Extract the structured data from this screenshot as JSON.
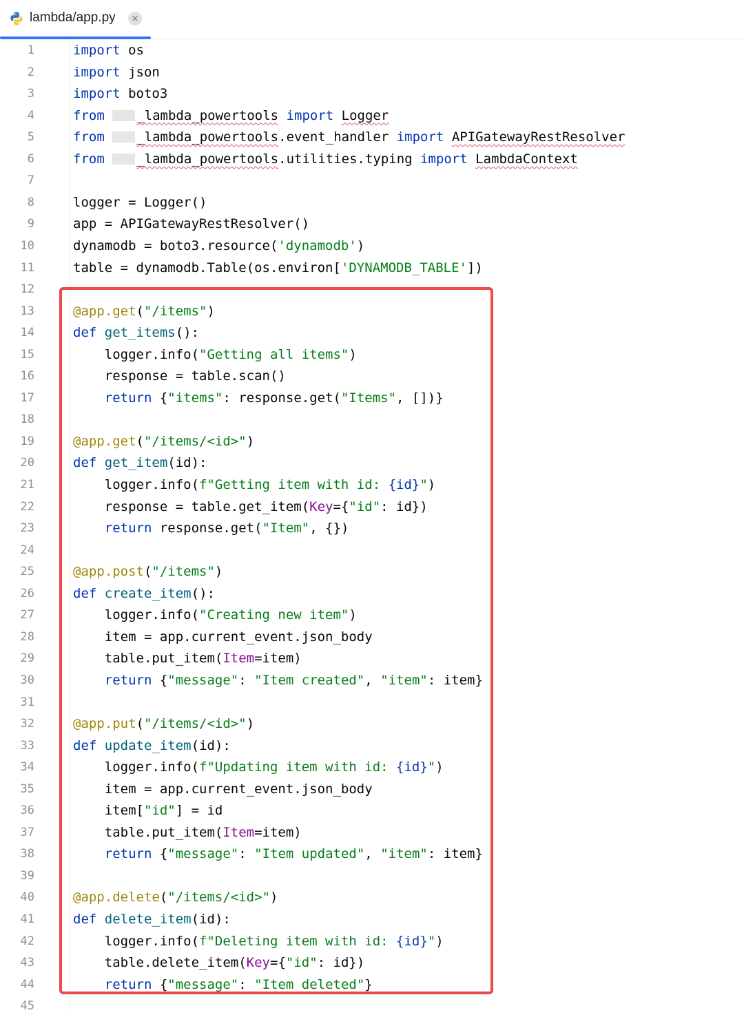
{
  "tab": {
    "label": "lambda/app.py",
    "close_icon": "×",
    "file_icon": "python-icon"
  },
  "colors": {
    "keyword": "#0033b3",
    "string": "#067d17",
    "decorator": "#9e880d",
    "function": "#00627a",
    "param": "#871094",
    "highlight_border": "#ea4a48",
    "tab_underline": "#3574f0"
  },
  "lines": [
    {
      "n": "1",
      "tokens": [
        {
          "t": "import",
          "c": "kw"
        },
        {
          "t": " os"
        }
      ]
    },
    {
      "n": "2",
      "tokens": [
        {
          "t": "import",
          "c": "kw"
        },
        {
          "t": " json"
        }
      ]
    },
    {
      "n": "3",
      "tokens": [
        {
          "t": "import",
          "c": "kw"
        },
        {
          "t": " boto3"
        }
      ]
    },
    {
      "n": "4",
      "tokens": [
        {
          "t": "from",
          "c": "kw"
        },
        {
          "t": " "
        },
        {
          "t": "",
          "c": "redact"
        },
        {
          "t": "_lambda_powertools",
          "c": "err"
        },
        {
          "t": " "
        },
        {
          "t": "import",
          "c": "kw"
        },
        {
          "t": " "
        },
        {
          "t": "Logger",
          "c": "err"
        }
      ]
    },
    {
      "n": "5",
      "tokens": [
        {
          "t": "from",
          "c": "kw"
        },
        {
          "t": " "
        },
        {
          "t": "",
          "c": "redact"
        },
        {
          "t": "_lambda_powertools",
          "c": "err"
        },
        {
          "t": ".event_handler "
        },
        {
          "t": "import",
          "c": "kw"
        },
        {
          "t": " "
        },
        {
          "t": "APIGatewayRestResolver",
          "c": "err"
        }
      ]
    },
    {
      "n": "6",
      "tokens": [
        {
          "t": "from",
          "c": "kw"
        },
        {
          "t": " "
        },
        {
          "t": "",
          "c": "redact"
        },
        {
          "t": "_lambda_powertools",
          "c": "err"
        },
        {
          "t": ".utilities.typing "
        },
        {
          "t": "import",
          "c": "kw"
        },
        {
          "t": " "
        },
        {
          "t": "LambdaContext",
          "c": "err"
        }
      ]
    },
    {
      "n": "7",
      "tokens": []
    },
    {
      "n": "8",
      "tokens": [
        {
          "t": "logger = Logger()"
        }
      ]
    },
    {
      "n": "9",
      "tokens": [
        {
          "t": "app = APIGatewayRestResolver()"
        }
      ]
    },
    {
      "n": "10",
      "tokens": [
        {
          "t": "dynamodb = boto3.resource("
        },
        {
          "t": "'dynamodb'",
          "c": "str"
        },
        {
          "t": ")"
        }
      ]
    },
    {
      "n": "11",
      "tokens": [
        {
          "t": "table = dynamodb.Table(os.environ["
        },
        {
          "t": "'DYNAMODB_TABLE'",
          "c": "str"
        },
        {
          "t": "])"
        }
      ]
    },
    {
      "n": "12",
      "tokens": []
    },
    {
      "n": "13",
      "tokens": [
        {
          "t": "@app.get",
          "c": "dec"
        },
        {
          "t": "("
        },
        {
          "t": "\"/items\"",
          "c": "str"
        },
        {
          "t": ")"
        }
      ]
    },
    {
      "n": "14",
      "tokens": [
        {
          "t": "def",
          "c": "kw"
        },
        {
          "t": " "
        },
        {
          "t": "get_items",
          "c": "fn"
        },
        {
          "t": "():"
        }
      ]
    },
    {
      "n": "15",
      "tokens": [
        {
          "t": "    logger.info("
        },
        {
          "t": "\"Getting all items\"",
          "c": "str"
        },
        {
          "t": ")"
        }
      ]
    },
    {
      "n": "16",
      "tokens": [
        {
          "t": "    response = table.scan()"
        }
      ]
    },
    {
      "n": "17",
      "tokens": [
        {
          "t": "    "
        },
        {
          "t": "return",
          "c": "kw"
        },
        {
          "t": " {"
        },
        {
          "t": "\"items\"",
          "c": "str"
        },
        {
          "t": ": response.get("
        },
        {
          "t": "\"Items\"",
          "c": "str"
        },
        {
          "t": ", [])}"
        }
      ]
    },
    {
      "n": "18",
      "tokens": []
    },
    {
      "n": "19",
      "tokens": [
        {
          "t": "@app.get",
          "c": "dec"
        },
        {
          "t": "("
        },
        {
          "t": "\"/items/<id>\"",
          "c": "str"
        },
        {
          "t": ")"
        }
      ]
    },
    {
      "n": "20",
      "tokens": [
        {
          "t": "def",
          "c": "kw"
        },
        {
          "t": " "
        },
        {
          "t": "get_item",
          "c": "fn"
        },
        {
          "t": "(id):"
        }
      ]
    },
    {
      "n": "21",
      "tokens": [
        {
          "t": "    logger.info("
        },
        {
          "t": "f\"Getting item with id: ",
          "c": "str"
        },
        {
          "t": "{id}",
          "c": "kw"
        },
        {
          "t": "\"",
          "c": "str"
        },
        {
          "t": ")"
        }
      ]
    },
    {
      "n": "22",
      "tokens": [
        {
          "t": "    response = table.get_item("
        },
        {
          "t": "Key",
          "c": "param"
        },
        {
          "t": "={"
        },
        {
          "t": "\"id\"",
          "c": "str"
        },
        {
          "t": ": id})"
        }
      ]
    },
    {
      "n": "23",
      "tokens": [
        {
          "t": "    "
        },
        {
          "t": "return",
          "c": "kw"
        },
        {
          "t": " response.get("
        },
        {
          "t": "\"Item\"",
          "c": "str"
        },
        {
          "t": ", {})"
        }
      ]
    },
    {
      "n": "24",
      "tokens": []
    },
    {
      "n": "25",
      "tokens": [
        {
          "t": "@app.post",
          "c": "dec"
        },
        {
          "t": "("
        },
        {
          "t": "\"/items\"",
          "c": "str"
        },
        {
          "t": ")"
        }
      ]
    },
    {
      "n": "26",
      "tokens": [
        {
          "t": "def",
          "c": "kw"
        },
        {
          "t": " "
        },
        {
          "t": "create_item",
          "c": "fn"
        },
        {
          "t": "():"
        }
      ]
    },
    {
      "n": "27",
      "tokens": [
        {
          "t": "    logger.info("
        },
        {
          "t": "\"Creating new item\"",
          "c": "str"
        },
        {
          "t": ")"
        }
      ]
    },
    {
      "n": "28",
      "tokens": [
        {
          "t": "    item = app.current_event.json_body"
        }
      ]
    },
    {
      "n": "29",
      "tokens": [
        {
          "t": "    table.put_item("
        },
        {
          "t": "Item",
          "c": "param"
        },
        {
          "t": "=item)"
        }
      ]
    },
    {
      "n": "30",
      "tokens": [
        {
          "t": "    "
        },
        {
          "t": "return",
          "c": "kw"
        },
        {
          "t": " {"
        },
        {
          "t": "\"message\"",
          "c": "str"
        },
        {
          "t": ": "
        },
        {
          "t": "\"Item created\"",
          "c": "str"
        },
        {
          "t": ", "
        },
        {
          "t": "\"item\"",
          "c": "str"
        },
        {
          "t": ": item}"
        }
      ]
    },
    {
      "n": "31",
      "tokens": []
    },
    {
      "n": "32",
      "tokens": [
        {
          "t": "@app.put",
          "c": "dec"
        },
        {
          "t": "("
        },
        {
          "t": "\"/items/<id>\"",
          "c": "str"
        },
        {
          "t": ")"
        }
      ]
    },
    {
      "n": "33",
      "tokens": [
        {
          "t": "def",
          "c": "kw"
        },
        {
          "t": " "
        },
        {
          "t": "update_item",
          "c": "fn"
        },
        {
          "t": "(id):"
        }
      ]
    },
    {
      "n": "34",
      "tokens": [
        {
          "t": "    logger.info("
        },
        {
          "t": "f\"Updating item with id: ",
          "c": "str"
        },
        {
          "t": "{id}",
          "c": "kw"
        },
        {
          "t": "\"",
          "c": "str"
        },
        {
          "t": ")"
        }
      ]
    },
    {
      "n": "35",
      "tokens": [
        {
          "t": "    item = app.current_event.json_body"
        }
      ]
    },
    {
      "n": "36",
      "tokens": [
        {
          "t": "    item["
        },
        {
          "t": "\"id\"",
          "c": "str"
        },
        {
          "t": "] = id"
        }
      ]
    },
    {
      "n": "37",
      "tokens": [
        {
          "t": "    table.put_item("
        },
        {
          "t": "Item",
          "c": "param"
        },
        {
          "t": "=item)"
        }
      ]
    },
    {
      "n": "38",
      "tokens": [
        {
          "t": "    "
        },
        {
          "t": "return",
          "c": "kw"
        },
        {
          "t": " {"
        },
        {
          "t": "\"message\"",
          "c": "str"
        },
        {
          "t": ": "
        },
        {
          "t": "\"Item updated\"",
          "c": "str"
        },
        {
          "t": ", "
        },
        {
          "t": "\"item\"",
          "c": "str"
        },
        {
          "t": ": item}"
        }
      ]
    },
    {
      "n": "39",
      "tokens": []
    },
    {
      "n": "40",
      "tokens": [
        {
          "t": "@app.delete",
          "c": "dec"
        },
        {
          "t": "("
        },
        {
          "t": "\"/items/<id>\"",
          "c": "str"
        },
        {
          "t": ")"
        }
      ]
    },
    {
      "n": "41",
      "tokens": [
        {
          "t": "def",
          "c": "kw"
        },
        {
          "t": " "
        },
        {
          "t": "delete_item",
          "c": "fn"
        },
        {
          "t": "(id):"
        }
      ]
    },
    {
      "n": "42",
      "tokens": [
        {
          "t": "    logger.info("
        },
        {
          "t": "f\"Deleting item with id: ",
          "c": "str"
        },
        {
          "t": "{id}",
          "c": "kw"
        },
        {
          "t": "\"",
          "c": "str"
        },
        {
          "t": ")"
        }
      ]
    },
    {
      "n": "43",
      "tokens": [
        {
          "t": "    table.delete_item("
        },
        {
          "t": "Key",
          "c": "param"
        },
        {
          "t": "={"
        },
        {
          "t": "\"id\"",
          "c": "str"
        },
        {
          "t": ": id})"
        }
      ]
    },
    {
      "n": "44",
      "tokens": [
        {
          "t": "    "
        },
        {
          "t": "return",
          "c": "kw"
        },
        {
          "t": " {"
        },
        {
          "t": "\"message\"",
          "c": "str"
        },
        {
          "t": ": "
        },
        {
          "t": "\"Item deleted\"",
          "c": "str"
        },
        {
          "t": "}"
        }
      ]
    },
    {
      "n": "45",
      "tokens": []
    }
  ]
}
